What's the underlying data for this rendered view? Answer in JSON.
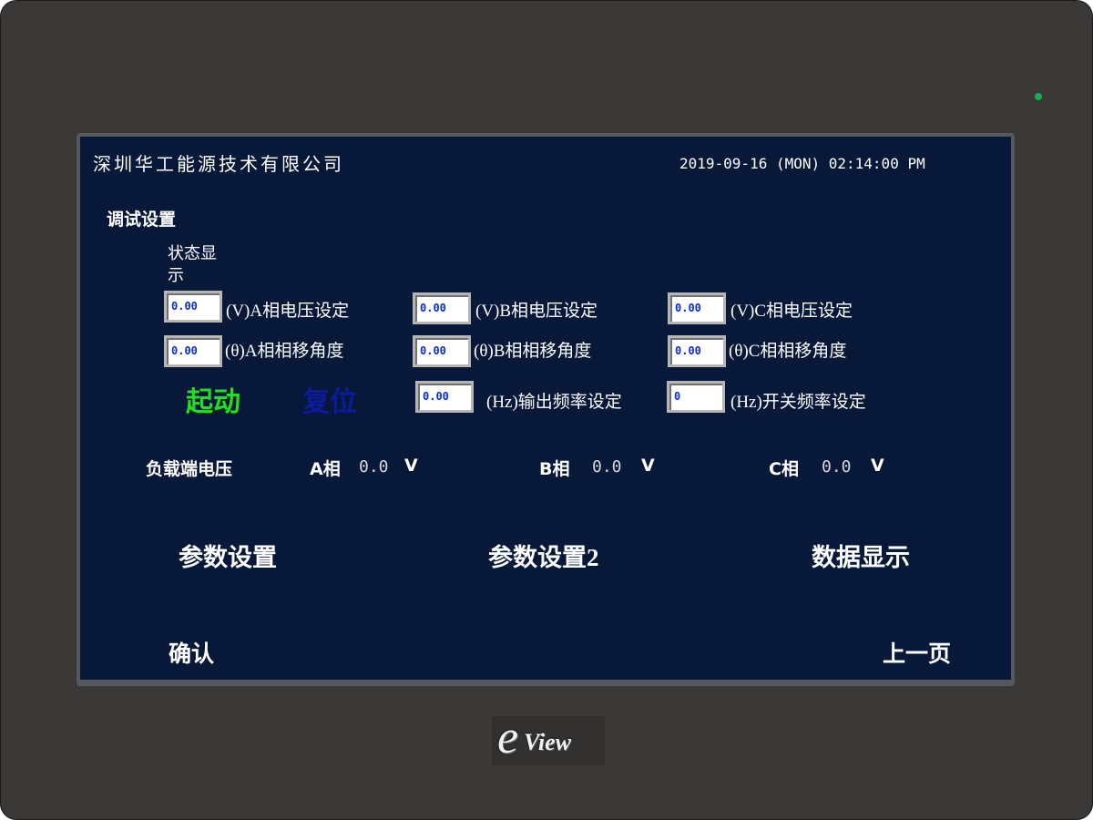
{
  "header": {
    "company": "深圳华工能源技术有限公司",
    "datetime": "2019-09-16 (MON) 02:14:00 PM"
  },
  "section_title": "调试设置",
  "status_label": "状态显示",
  "settings": {
    "a_voltage": {
      "value": "0.00",
      "label": "(V)A相电压设定"
    },
    "b_voltage": {
      "value": "0.00",
      "label": "(V)B相电压设定"
    },
    "c_voltage": {
      "value": "0.00",
      "label": "(V)C相电压设定"
    },
    "a_phase": {
      "value": "0.00",
      "label": "(θ)A相相移角度"
    },
    "b_phase": {
      "value": "0.00",
      "label": "(θ)B相相移角度"
    },
    "c_phase": {
      "value": "0.00",
      "label": "(θ)C相相移角度"
    },
    "output_freq": {
      "value": "0.00",
      "label": "(Hz)输出频率设定"
    },
    "switch_freq": {
      "value": "0",
      "label": "(Hz)开关频率设定"
    }
  },
  "controls": {
    "start": "起动",
    "reset": "复位",
    "start_color": "#22e01f",
    "reset_color": "#0d1a9a"
  },
  "load_voltage": {
    "title": "负载端电压",
    "phases": [
      {
        "name": "A相",
        "value": "0.0",
        "unit": "V"
      },
      {
        "name": "B相",
        "value": "0.0",
        "unit": "V"
      },
      {
        "name": "C相",
        "value": "0.0",
        "unit": "V"
      }
    ]
  },
  "nav": {
    "param_settings": "参数设置",
    "param_settings2": "参数设置2",
    "data_display": "数据显示",
    "confirm": "确认",
    "prev_page": "上一页"
  },
  "brand": {
    "logo_letter": "e",
    "logo_text": "View"
  },
  "colors": {
    "screen_bg": "#071839",
    "input_text": "#0a2bd0",
    "bezel": "#3b3937",
    "led": "#18b24a"
  }
}
